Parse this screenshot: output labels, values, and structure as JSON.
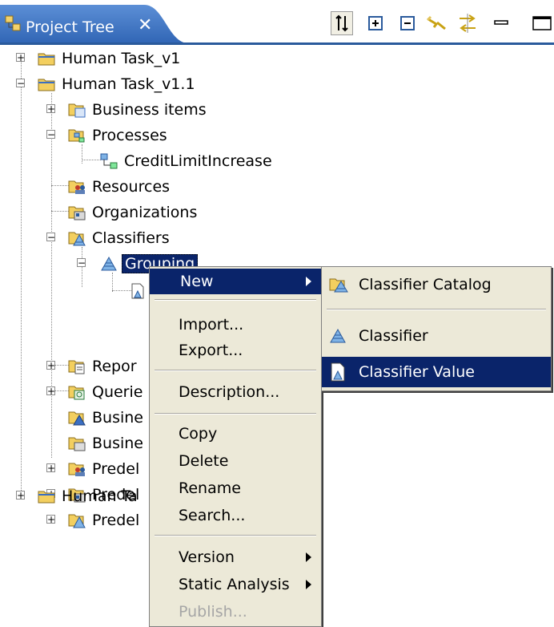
{
  "view": {
    "title": "Project Tree",
    "close_glyph": "✕",
    "toolbar_icons": [
      "sort-icon",
      "expand-all-icon",
      "collapse-all-icon",
      "link-with-editor-icon",
      "filter-icon",
      "minimize-icon",
      "maximize-icon"
    ]
  },
  "tree": {
    "nodes": [
      {
        "label": "Human Task_v1"
      },
      {
        "label": "Human Task_v1.1"
      },
      {
        "label": "Business items"
      },
      {
        "label": "Processes"
      },
      {
        "label": "CreditLimitIncrease"
      },
      {
        "label": "Resources"
      },
      {
        "label": "Organizations"
      },
      {
        "label": "Classifiers"
      },
      {
        "label": "Grouping"
      },
      {
        "label": "Repor"
      },
      {
        "label": "Querie"
      },
      {
        "label": "Busine"
      },
      {
        "label": "Busine"
      },
      {
        "label": "Predel"
      },
      {
        "label": "Predel"
      },
      {
        "label": "Predel"
      },
      {
        "label": "Human Ta"
      }
    ]
  },
  "context_menu": {
    "items": [
      {
        "label": "New"
      },
      {
        "label": "Import..."
      },
      {
        "label": "Export..."
      },
      {
        "label": "Description..."
      },
      {
        "label": "Copy"
      },
      {
        "label": "Delete"
      },
      {
        "label": "Rename"
      },
      {
        "label": "Search..."
      },
      {
        "label": "Version"
      },
      {
        "label": "Static Analysis"
      },
      {
        "label": "Publish..."
      }
    ]
  },
  "submenu": {
    "items": [
      {
        "label": "Classifier Catalog"
      },
      {
        "label": "Classifier"
      },
      {
        "label": "Classifier Value"
      }
    ]
  },
  "colors": {
    "selection": "#0a246a",
    "tab": "#3a6fc4",
    "menu_bg": "#ece9d8",
    "disabled": "#a6a6a6"
  }
}
